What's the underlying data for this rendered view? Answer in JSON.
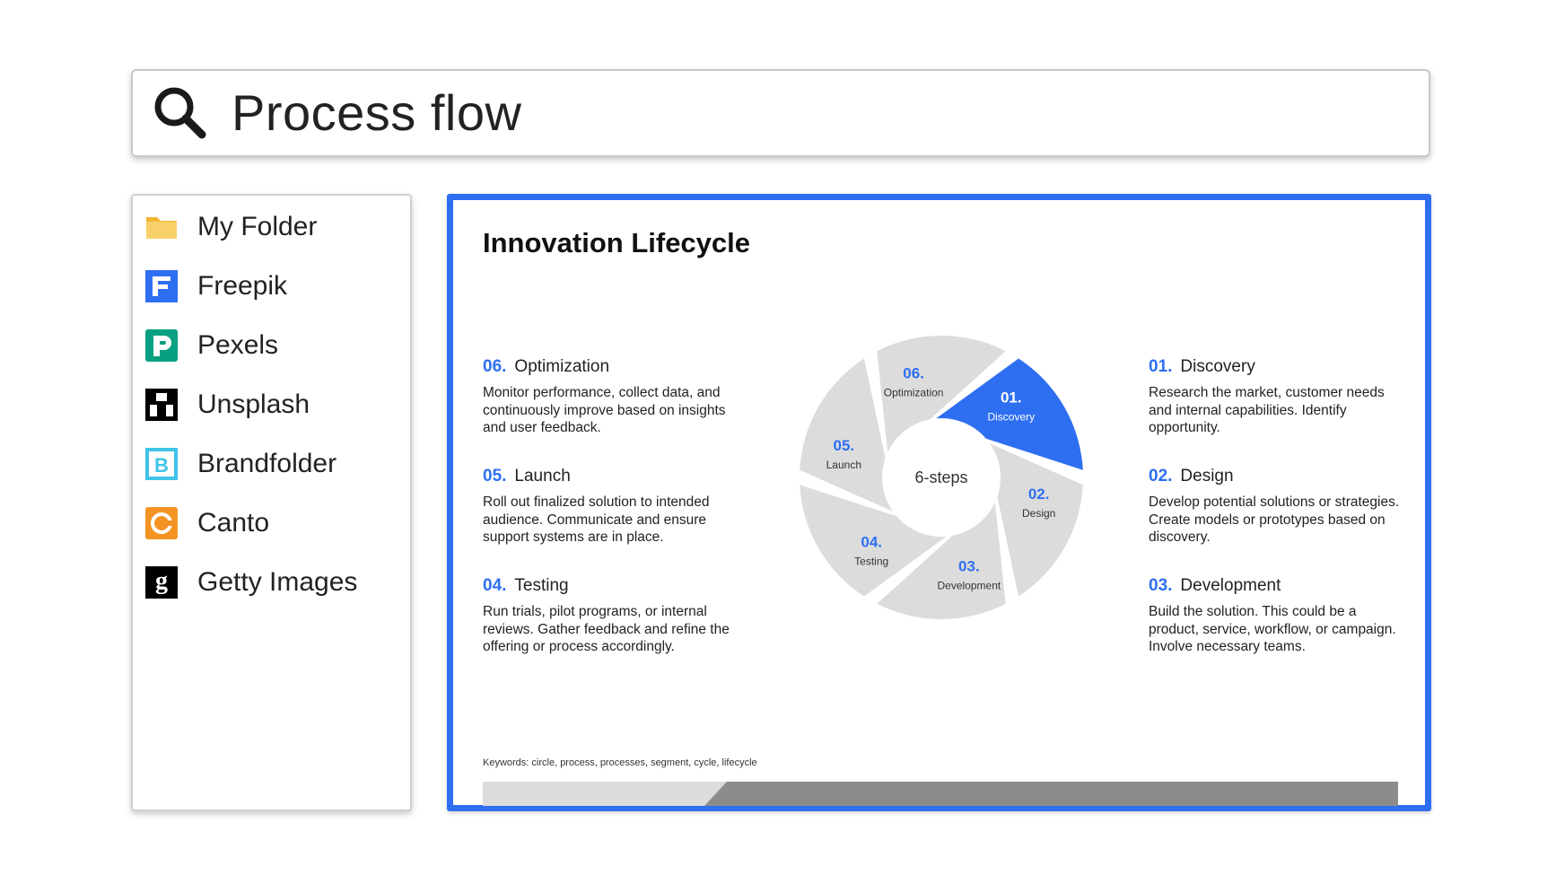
{
  "search": {
    "query": "Process flow",
    "icon": "search-icon"
  },
  "sidebar": {
    "items": [
      {
        "label": "My Folder",
        "icon": "folder-icon",
        "color": "#f6c94a"
      },
      {
        "label": "Freepik",
        "icon": "freepik-icon",
        "color": "#2e6ff2"
      },
      {
        "label": "Pexels",
        "icon": "pexels-icon",
        "color": "#07a081"
      },
      {
        "label": "Unsplash",
        "icon": "unsplash-icon",
        "color": "#000000"
      },
      {
        "label": "Brandfolder",
        "icon": "brandfolder-icon",
        "color": "#40c4e8"
      },
      {
        "label": "Canto",
        "icon": "canto-icon",
        "color": "#f39422"
      },
      {
        "label": "Getty Images",
        "icon": "getty-images-icon",
        "color": "#000000"
      }
    ]
  },
  "slide": {
    "title": "Innovation Lifecycle",
    "center_label": "6-steps",
    "accent_color": "#2e6ff2",
    "highlighted_step": "01.",
    "steps": [
      {
        "num": "01.",
        "name": "Discovery",
        "desc": "Research the market, customer needs and internal capabilities. Identify opportunity."
      },
      {
        "num": "02.",
        "name": "Design",
        "desc": "Develop potential solutions or strategies. Create models or prototypes based on discovery."
      },
      {
        "num": "03.",
        "name": "Development",
        "desc": "Build the solution. This could be a product, service, workflow, or campaign. Involve necessary teams."
      },
      {
        "num": "04.",
        "name": "Testing",
        "desc": "Run trials, pilot programs, or internal reviews. Gather feedback and refine the offering or process accordingly."
      },
      {
        "num": "05.",
        "name": "Launch",
        "desc": "Roll out finalized solution to intended audience. Communicate and ensure support systems are in place."
      },
      {
        "num": "06.",
        "name": "Optimization",
        "desc": "Monitor performance, collect data, and continuously improve based on insights and user feedback."
      }
    ],
    "keywords": "Keywords: circle, process, processes, segment, cycle, lifecycle"
  }
}
